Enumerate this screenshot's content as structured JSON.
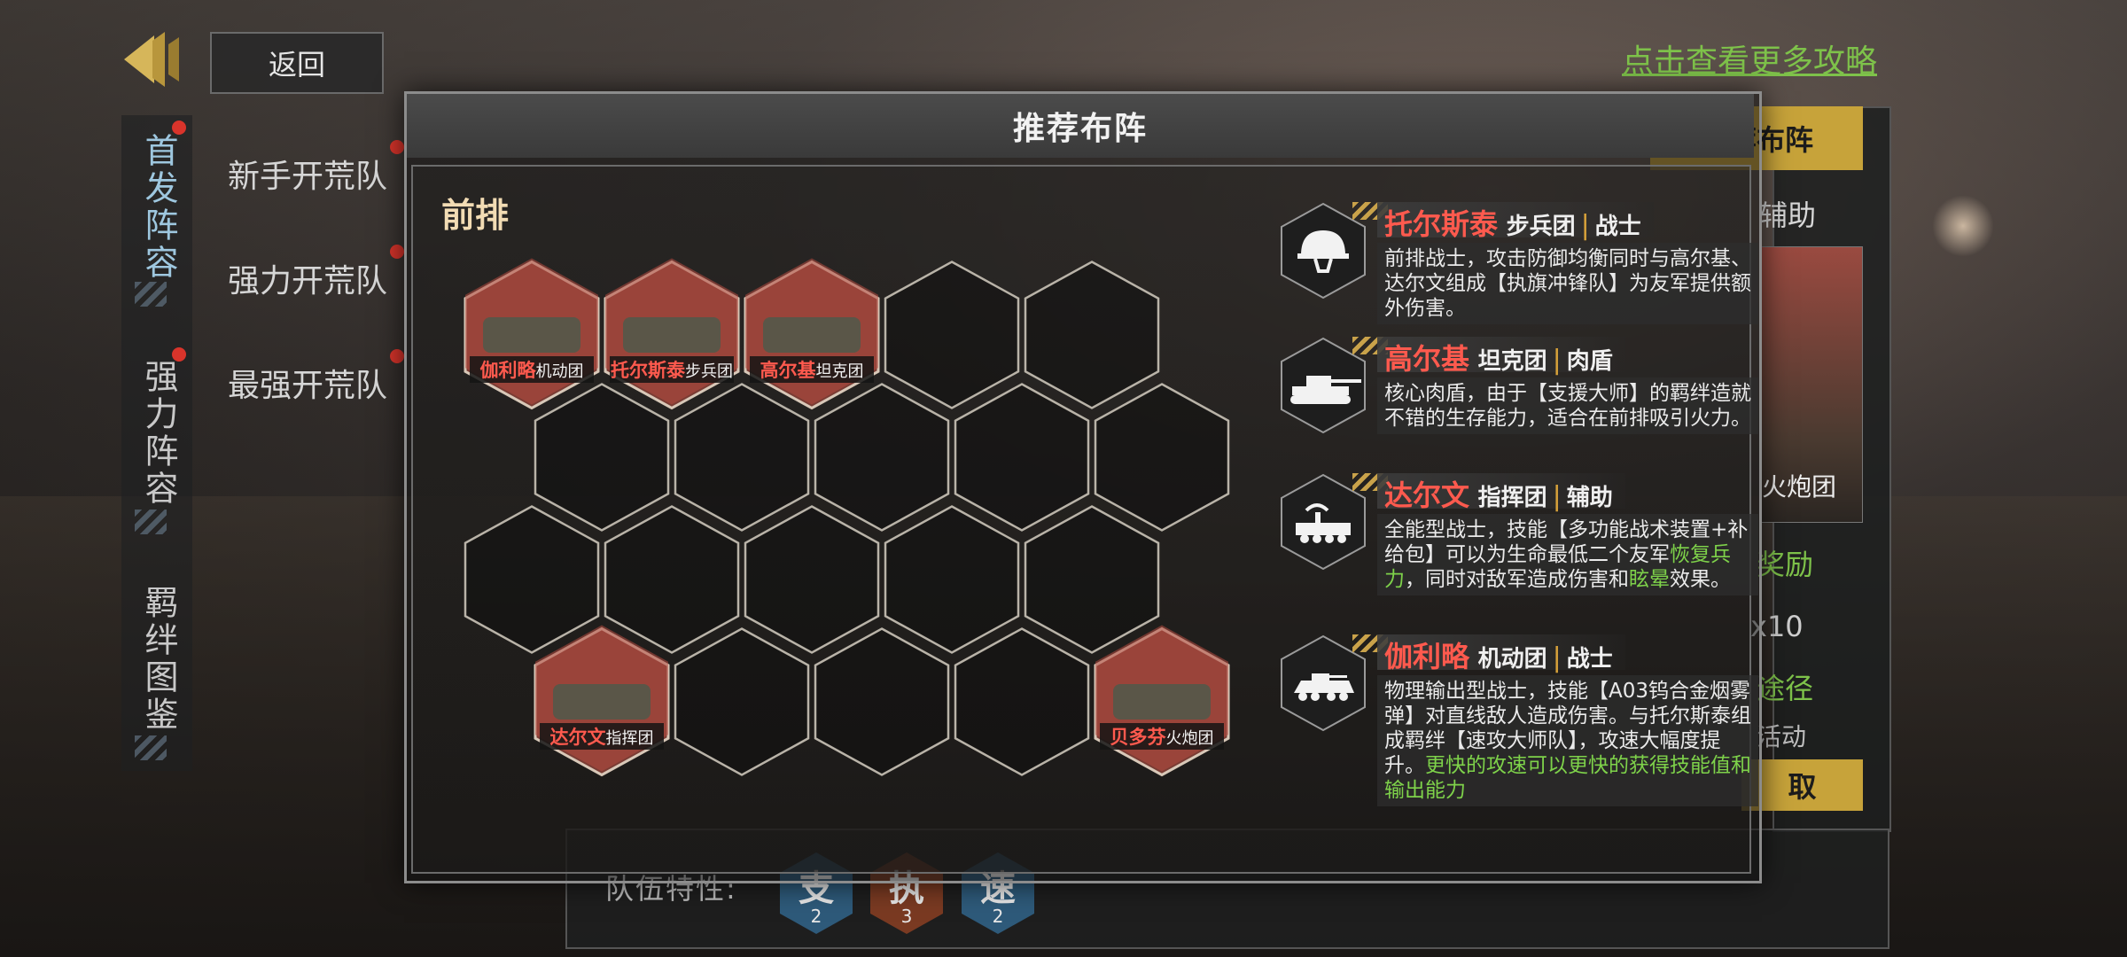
{
  "nav": {
    "back_label": "返回",
    "side_tabs": [
      {
        "label": "首发阵容",
        "active": true
      },
      {
        "label": "强力阵容",
        "active": false
      },
      {
        "label": "羁绊图鉴",
        "active": false
      }
    ],
    "sub_tabs": [
      "新手开荒队",
      "强力开荒队",
      "最强开荒队"
    ]
  },
  "header": {
    "guide_link": "点击查看更多攻略"
  },
  "right_panel": {
    "recommend_tab": "推荐布阵",
    "support_label": "辅助",
    "card_unit": "火炮团",
    "reward_label": "奖励",
    "reward_count": "x10",
    "source_label": "途径",
    "activity_label": "活动",
    "claim_button": "取"
  },
  "team": {
    "label": "队伍特性:",
    "traits": [
      {
        "glyph": "支",
        "count": "2",
        "color": "#2e5a7a"
      },
      {
        "glyph": "执",
        "count": "3",
        "color": "#7a3a22"
      },
      {
        "glyph": "速",
        "count": "2",
        "color": "#2e5a7a"
      }
    ]
  },
  "modal": {
    "title": "推荐布阵",
    "front_label": "前排",
    "board_units": [
      {
        "row": 0,
        "col": 0,
        "name": "伽利略",
        "type": "机动团"
      },
      {
        "row": 0,
        "col": 1,
        "name": "托尔斯泰",
        "type": "步兵团"
      },
      {
        "row": 0,
        "col": 2,
        "name": "高尔基",
        "type": "坦克团"
      },
      {
        "row": 3,
        "col": 0,
        "name": "达尔文",
        "type": "指挥团"
      },
      {
        "row": 3,
        "col": 4,
        "name": "贝多芬",
        "type": "火炮团"
      }
    ],
    "heroes": [
      {
        "name": "托尔斯泰",
        "unit": "步兵团",
        "role": "战士",
        "icon": "helmet-icon",
        "desc": [
          {
            "t": "前排战士，攻击防御均衡同时与高尔基、达尔文组成【执旗冲锋队】为友军提供额外伤害。"
          }
        ]
      },
      {
        "name": "高尔基",
        "unit": "坦克团",
        "role": "肉盾",
        "icon": "tank-icon",
        "desc": [
          {
            "t": "核心肉盾，由于【支援大师】的羁绊造就不错的生存能力，适合在前排吸引火力。"
          }
        ]
      },
      {
        "name": "达尔文",
        "unit": "指挥团",
        "role": "辅助",
        "icon": "radar-vehicle-icon",
        "desc": [
          {
            "t": "全能型战士，技能【多功能战术装置+补给包】可以为生命最低二个友军"
          },
          {
            "t": "恢复兵力",
            "g": true
          },
          {
            "t": "，同时对敌军造成伤害和"
          },
          {
            "t": "眩晕",
            "g": true
          },
          {
            "t": "效果。"
          }
        ]
      },
      {
        "name": "伽利略",
        "unit": "机动团",
        "role": "战士",
        "icon": "apc-icon",
        "desc": [
          {
            "t": "物理输出型战士，技能【A03钨合金烟雾弹】对直线敌人造成伤害。与托尔斯泰组成羁绊【速攻大师队】，攻速大幅度提升。"
          },
          {
            "t": "更快的攻速可以更快的获得技能值和输出能力",
            "g": true
          }
        ]
      }
    ]
  },
  "colors": {
    "accent_gold": "#c7a33a",
    "hero_name_red": "#ff5a4e",
    "highlight_green": "#7ed24a",
    "link_green": "#7ec24a"
  }
}
